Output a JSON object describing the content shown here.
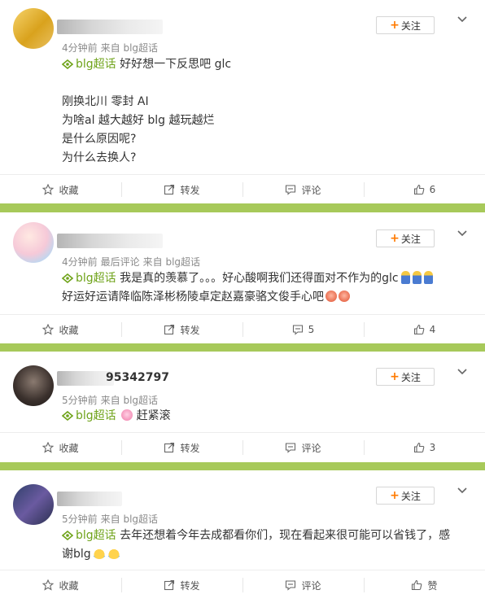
{
  "accent": "#6fa31a",
  "separator_color": "#a7c95a",
  "posts": [
    {
      "meta": [
        "4分钟前",
        "来自 blg超话"
      ],
      "follow_label": "关注",
      "tag": "blg超话",
      "lines": [
        "好好想一下反思吧 glc",
        "",
        "刚换北川 零封 AI",
        "为啥al 越大越好 blg 越玩越烂",
        "是什么原因呢?",
        "为什么去换人?"
      ],
      "actions": {
        "fav": "收藏",
        "repost": "转发",
        "comment": "评论",
        "like": "6"
      }
    },
    {
      "meta": [
        "4分钟前",
        "最后评论",
        "来自 blg超话"
      ],
      "follow_label": "关注",
      "tag": "blg超话",
      "line1": "我是真的羡慕了。。。好心酸啊我们还得面对不作为的glc",
      "line2": "好运好运请降临陈泽彬杨陵卓定赵嘉豪骆文俊手心吧",
      "actions": {
        "fav": "收藏",
        "repost": "转发",
        "comment": "5",
        "like": "4"
      }
    },
    {
      "name_partial": "95342797",
      "meta": [
        "5分钟前",
        "来自 blg超话"
      ],
      "follow_label": "关注",
      "tag": "blg超话",
      "text": "赶紧滚",
      "actions": {
        "fav": "收藏",
        "repost": "转发",
        "comment": "评论",
        "like": "3"
      }
    },
    {
      "meta": [
        "5分钟前",
        "来自 blg超话"
      ],
      "follow_label": "关注",
      "tag": "blg超话",
      "line1": "去年还想着今年去成都看你们，现在看起来很可能可以省钱了，感",
      "line2": "谢blg",
      "actions": {
        "fav": "收藏",
        "repost": "转发",
        "comment": "评论",
        "like": "赞"
      }
    }
  ]
}
